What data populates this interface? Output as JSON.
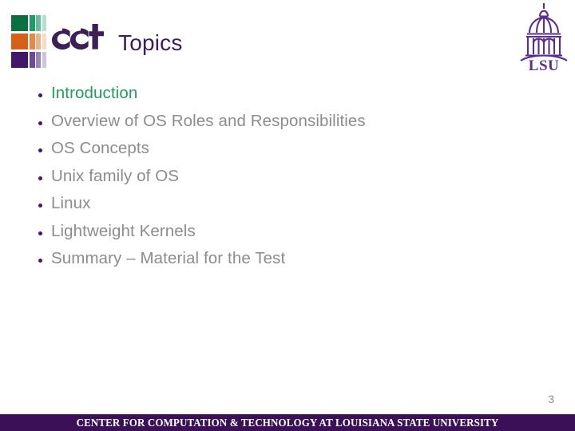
{
  "slide": {
    "title": "Topics",
    "page_number": "3",
    "background_color": "#ffffff"
  },
  "header": {
    "cct_logo": {
      "wordmark": "cct",
      "mark_name": "cct-block-grid",
      "row_colors": [
        "#0a7040",
        "#d4601a",
        "#44166b"
      ]
    },
    "lsu_logo": {
      "wordmark": "LSU",
      "mark_name": "lsu-campanile-tower",
      "color": "#5b2d8e"
    },
    "title_color": "#3b1f55"
  },
  "body": {
    "bullets": [
      {
        "label": "Introduction",
        "color": "#1f9e5e"
      },
      {
        "label": "Overview of OS Roles and Responsibilities",
        "color": "#8c8c8c"
      },
      {
        "label": "OS Concepts",
        "color": "#8c8c8c"
      },
      {
        "label": "Unix family of OS",
        "color": "#8c8c8c"
      },
      {
        "label": "Linux",
        "color": "#8c8c8c"
      },
      {
        "label": "Lightweight Kernels",
        "color": "#8c8c8c"
      },
      {
        "label": "Summary – Material for the Test",
        "color": "#8c8c8c"
      }
    ]
  },
  "footer": {
    "text": "CENTER FOR COMPUTATION & TECHNOLOGY AT LOUISIANA STATE UNIVERSITY",
    "background_color": "#3b1057",
    "text_color": "#ffffff"
  }
}
